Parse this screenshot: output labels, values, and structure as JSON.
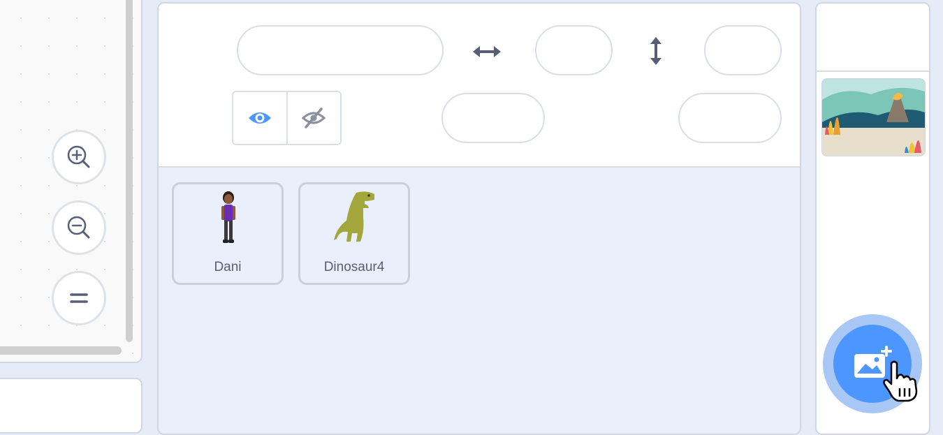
{
  "zoom_controls": {
    "zoom_in_icon": "zoom-in-icon",
    "zoom_out_icon": "zoom-out-icon",
    "reset_icon": "equals-icon"
  },
  "sprite_info": {
    "name_value": "",
    "x_value": "",
    "y_value": "",
    "size_value": "",
    "direction_value": "",
    "show_icon": "eye-icon",
    "hide_icon": "eye-slash-icon"
  },
  "sprites": [
    {
      "name": "Dani"
    },
    {
      "name": "Dinosaur4"
    }
  ],
  "stage": {
    "backdrop_icon": "choose-backdrop-icon"
  },
  "colors": {
    "accent": "#4c97ff",
    "panel_bg": "#e9f0fb",
    "text": "#575e75"
  }
}
